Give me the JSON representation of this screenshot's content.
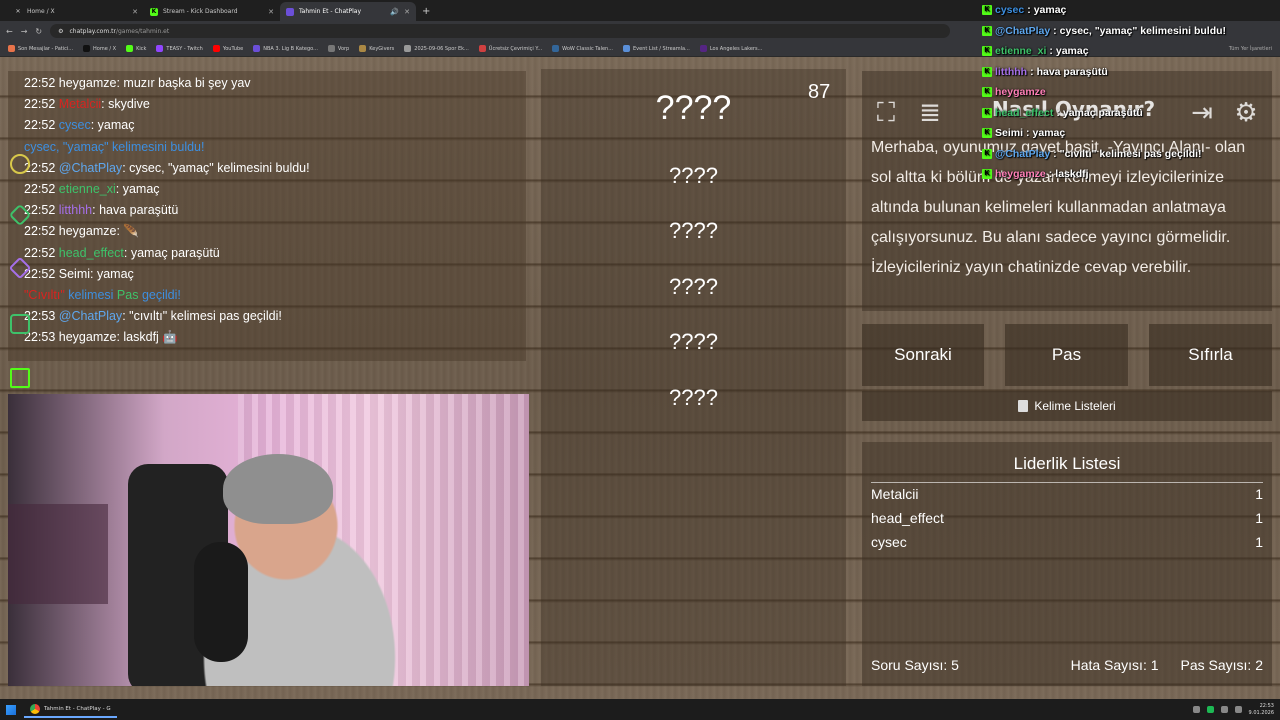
{
  "browser": {
    "tabs": [
      {
        "label": "Home / X",
        "icon": "x-icon",
        "active": false
      },
      {
        "label": "Stream - Kick Dashboard",
        "icon": "kick-icon",
        "active": false
      },
      {
        "label": "Tahmin Et - ChatPlay",
        "icon": "chatplay-icon",
        "active": true
      }
    ],
    "url_domain": "chatplay.com.tr",
    "url_path": "/games/tahmin.et",
    "bookmarks": [
      "Son Mesajlar - Patici...",
      "Home / X",
      "Kick",
      "TEASY - Twitch",
      "YouTube",
      "NBA 3. Lig B Katego...",
      "Vorp",
      "KeyGivers",
      "2025-09-06 Spor Ek...",
      "Ücretsiz Çevrimiçi Y...",
      "WoW Classic Talen...",
      "Event List / Streamla...",
      "Los Angeles Lakers..."
    ],
    "all_bookmarks": "Tüm Yer İşaretleri"
  },
  "chat": [
    {
      "time": "22:52",
      "user": "heygamze",
      "user_color": "#ffffff",
      "msg": "muzır başka bi şey yav"
    },
    {
      "time": "22:52",
      "user": "Metalcii",
      "user_color": "#d9231f",
      "msg": "skydive"
    },
    {
      "time": "22:52",
      "user": "cysec",
      "user_color": "#3d8fe0",
      "msg": "yamaç"
    },
    {
      "system": "cysec, \"yamaç\" kelimesini buldu!"
    },
    {
      "time": "22:52",
      "user": "@ChatPlay",
      "user_color": "#5ea7ee",
      "msg": "cysec, \"yamaç\" kelimesini buldu!"
    },
    {
      "time": "22:52",
      "user": "etienne_xi",
      "user_color": "#3ec26a",
      "msg": "yamaç"
    },
    {
      "time": "22:52",
      "user": "litthhh",
      "user_color": "#a56fe8",
      "msg": "hava paraşütü"
    },
    {
      "time": "22:52",
      "user": "heygamze",
      "user_color": "#ffffff",
      "msg": "🪶"
    },
    {
      "time": "22:52",
      "user": "head_effect",
      "user_color": "#3ec26a",
      "msg": "yamaç paraşütü"
    },
    {
      "time": "22:52",
      "user": "Seimi",
      "user_color": "#ffffff",
      "msg": "yamaç"
    },
    {
      "system_parts": [
        "\"Cıvıltı\"",
        " kelimesi ",
        "Pas",
        " geçildi!"
      ]
    },
    {
      "time": "22:53",
      "user": "@ChatPlay",
      "user_color": "#5ea7ee",
      "msg": "\"cıvıltı\" kelimesi pas geçildi!"
    },
    {
      "time": "22:53",
      "user": "heygamze",
      "user_color": "#ffffff",
      "msg": "laskdfj 🤖"
    }
  ],
  "game": {
    "counter": "87",
    "words": [
      "????",
      "????",
      "????",
      "????",
      "????",
      "????"
    ],
    "howto_title": "Nasıl Oynanır?",
    "howto_text": "Merhaba, oyunumuz gayet basit. -Yayıncı Alanı- olan sol altta ki bölüm de yazan kelimeyi izleyicilerinize altında bulunan kelimeleri kullanmadan anlatmaya çalışıyorsunuz. Bu alanı sadece yayıncı görmelidir. İzleyicileriniz yayın chatinizde cevap verebilir.",
    "buttons": {
      "next": "Sonraki",
      "pass": "Pas",
      "reset": "Sıfırla"
    },
    "word_lists": "Kelime Listeleri",
    "leaderboard_title": "Liderlik Listesi",
    "leaderboard": [
      {
        "name": "Metalcii",
        "score": "1"
      },
      {
        "name": "head_effect",
        "score": "1"
      },
      {
        "name": "cysec",
        "score": "1"
      }
    ],
    "stats": {
      "questions": "Soru Sayısı: 5",
      "errors": "Hata Sayısı: 1",
      "passes": "Pas Sayısı: 2"
    }
  },
  "overlay": [
    {
      "user": "cysec",
      "user_color": "#3d8fe0",
      "msg": "yamaç"
    },
    {
      "user": "@ChatPlay",
      "user_color": "#5ea7ee",
      "msg": "cysec, \"yamaç\" kelimesini buldu!"
    },
    {
      "user": "etienne_xi",
      "user_color": "#3ec26a",
      "msg": "yamaç"
    },
    {
      "user": "litthhh",
      "user_color": "#a56fe8",
      "msg": "hava paraşütü"
    },
    {
      "user": "heygamze",
      "user_color": "#ff7fb7",
      "msg": ""
    },
    {
      "user": "head_effect",
      "user_color": "#3ec26a",
      "msg": "yamaç paraşütü"
    },
    {
      "user": "Seimi",
      "user_color": "#ffffff",
      "msg": "yamaç"
    },
    {
      "user": "@ChatPlay",
      "user_color": "#5ea7ee",
      "msg": "\"cıvıltı\" kelimesi pas geçildi!"
    },
    {
      "user": "heygamze",
      "user_color": "#ff7fb7",
      "msg": "laskdfj"
    }
  ],
  "taskbar": {
    "app": "Tahmin Et - ChatPlay - G",
    "time": "22:53",
    "date": "9.01.2026"
  }
}
